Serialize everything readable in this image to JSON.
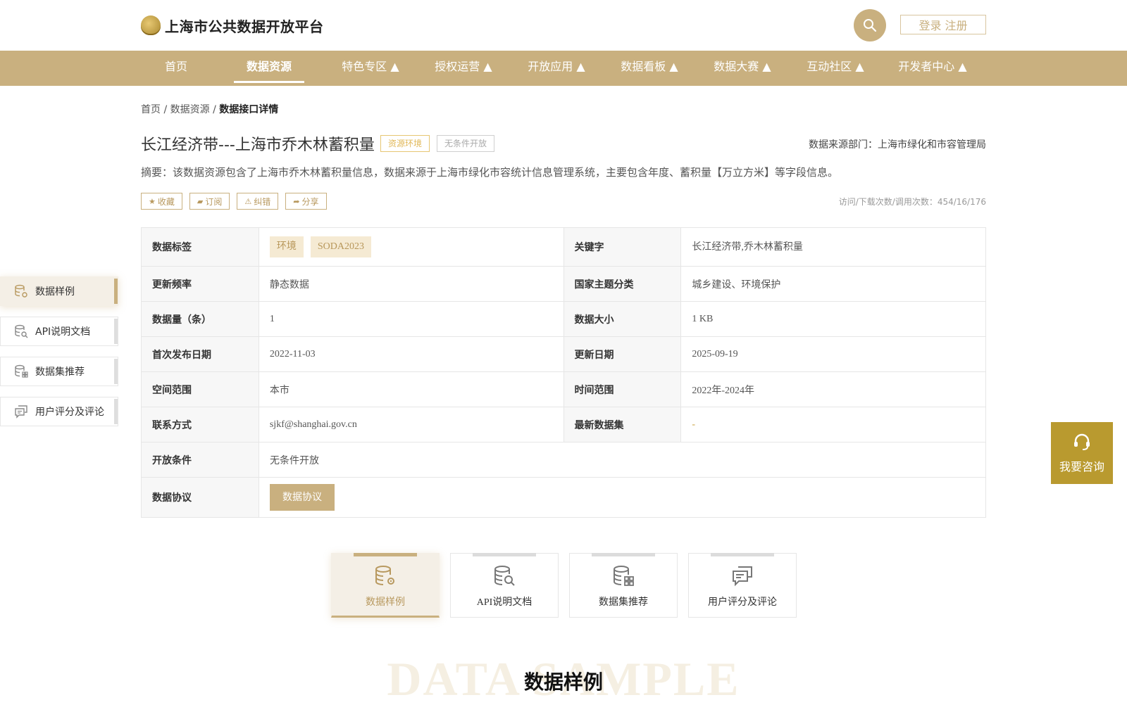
{
  "header": {
    "site_title": "上海市公共数据开放平台",
    "login_label": "登录 注册"
  },
  "nav": {
    "items": [
      {
        "label": "首页"
      },
      {
        "label": "数据资源"
      },
      {
        "label": "特色专区 ▲"
      },
      {
        "label": "授权运营 ▲"
      },
      {
        "label": "开放应用 ▲"
      },
      {
        "label": "数据看板 ▲"
      },
      {
        "label": "数据大赛 ▲"
      },
      {
        "label": "互动社区 ▲"
      },
      {
        "label": "开发者中心 ▲"
      }
    ],
    "active_index": 1
  },
  "breadcrumb": {
    "home": "首页",
    "sep1": " / ",
    "section": "数据资源",
    "sep2": " / ",
    "current": "数据接口详情"
  },
  "resource": {
    "title": "长江经济带---上海市乔木林蓄积量",
    "tag_env": "资源环境",
    "tag_open": "无条件开放",
    "source_dept": "数据来源部门：上海市绿化和市容管理局",
    "summary": "摘要：该数据资源包含了上海市乔木林蓄积量信息，数据来源于上海市绿化市容统计信息管理系统，主要包含年度、蓄积量【万立方米】等字段信息。",
    "stats": "访问/下载次数/调用次数：454/16/176"
  },
  "actions": {
    "favorite": "收藏",
    "subscribe": "订阅",
    "report": "纠错",
    "share": "分享"
  },
  "info": {
    "tags_label": "数据标签",
    "tags": [
      "环境",
      "SODA2023"
    ],
    "keywords_label": "关键字",
    "keywords": "长江经济带,乔木林蓄积量",
    "freq_label": "更新频率",
    "freq": "静态数据",
    "theme_label": "国家主题分类",
    "theme": "城乡建设、环境保护",
    "count_label": "数据量（条）",
    "count": "1",
    "size_label": "数据大小",
    "size": "1 KB",
    "first_pub_label": "首次发布日期",
    "first_pub": "2022-11-03",
    "update_label": "更新日期",
    "update": "2025-09-19",
    "space_label": "空间范围",
    "space": "本市",
    "time_label": "时间范围",
    "time": "2022年-2024年",
    "contact_label": "联系方式",
    "contact": "sjkf@shanghai.gov.cn",
    "latest_label": "最新数据集",
    "latest": "-",
    "open_cond_label": "开放条件",
    "open_cond": "无条件开放",
    "protocol_label": "数据协议",
    "protocol_btn": "数据协议"
  },
  "side_menu": {
    "items": [
      {
        "label": "数据样例"
      },
      {
        "label": "API说明文档"
      },
      {
        "label": "数据集推荐"
      },
      {
        "label": "用户评分及评论"
      }
    ],
    "active_index": 0
  },
  "consult": {
    "label": "我要咨询"
  },
  "tabs": {
    "items": [
      {
        "label": "数据样例"
      },
      {
        "label": "API说明文档"
      },
      {
        "label": "数据集推荐"
      },
      {
        "label": "用户评分及评论"
      }
    ],
    "active_index": 0
  },
  "section": {
    "bg_text": "DATA SAMPLE",
    "title": "数据样例"
  },
  "colors": {
    "accent": "#c9b07f",
    "accent_dark": "#b8995f",
    "consult_bg": "#b99a2f"
  }
}
